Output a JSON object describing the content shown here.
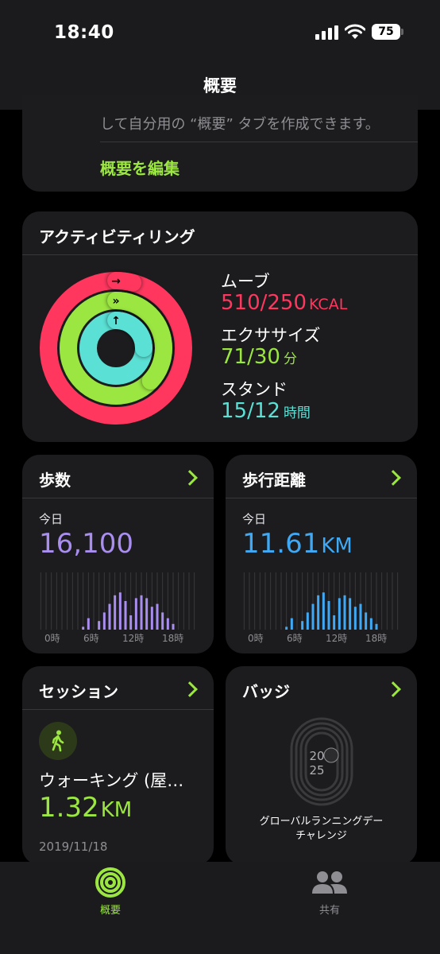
{
  "status_bar": {
    "time": "18:40",
    "battery": "75"
  },
  "nav": {
    "title": "概要"
  },
  "intro_card": {
    "text": "して自分用の “概要” タブを作成できます。",
    "edit_link": "概要を編集"
  },
  "activity": {
    "title": "アクティビティリング",
    "move": {
      "label": "ムーブ",
      "value": "510/250",
      "unit": "KCAL",
      "progress": 2.04,
      "color": "#ff375f"
    },
    "exercise": {
      "label": "エクササイズ",
      "value": "71/30",
      "unit": "分",
      "progress": 2.37,
      "color": "#9be640"
    },
    "stand": {
      "label": "スタンド",
      "value": "15/12",
      "unit": "時間",
      "progress": 1.25,
      "color": "#5ae0d4"
    }
  },
  "steps": {
    "title": "歩数",
    "period": "今日",
    "value": "16,100",
    "color": "#a98ef0",
    "ticks": [
      "0時",
      "6時",
      "12時",
      "18時"
    ],
    "bars": [
      0,
      0,
      0,
      0,
      0,
      0,
      0,
      0,
      0.05,
      0.2,
      0,
      0.15,
      0.3,
      0.45,
      0.6,
      0.65,
      0.5,
      0.25,
      0.55,
      0.6,
      0.55,
      0.4,
      0.45,
      0.3,
      0.2,
      0.1,
      0,
      0,
      0,
      0
    ]
  },
  "distance": {
    "title": "歩行距離",
    "period": "今日",
    "value": "11.61",
    "unit": "KM",
    "color": "#3fa9f5",
    "ticks": [
      "0時",
      "6時",
      "12時",
      "18時"
    ],
    "bars": [
      0,
      0,
      0,
      0,
      0,
      0,
      0,
      0,
      0.05,
      0.2,
      0,
      0.15,
      0.3,
      0.45,
      0.6,
      0.65,
      0.5,
      0.25,
      0.55,
      0.6,
      0.55,
      0.4,
      0.45,
      0.3,
      0.2,
      0.1,
      0,
      0,
      0,
      0
    ]
  },
  "session": {
    "title": "セッション",
    "name": "ウォーキング (屋…",
    "value": "1.32",
    "unit": "KM",
    "date": "2019/11/18"
  },
  "badge": {
    "title": "バッジ",
    "name_line1": "グローバルランニングデー",
    "name_line2": "チャレンジ",
    "emblem": "2025"
  },
  "tabs": [
    {
      "label": "概要",
      "active": true
    },
    {
      "label": "共有",
      "active": false
    }
  ]
}
